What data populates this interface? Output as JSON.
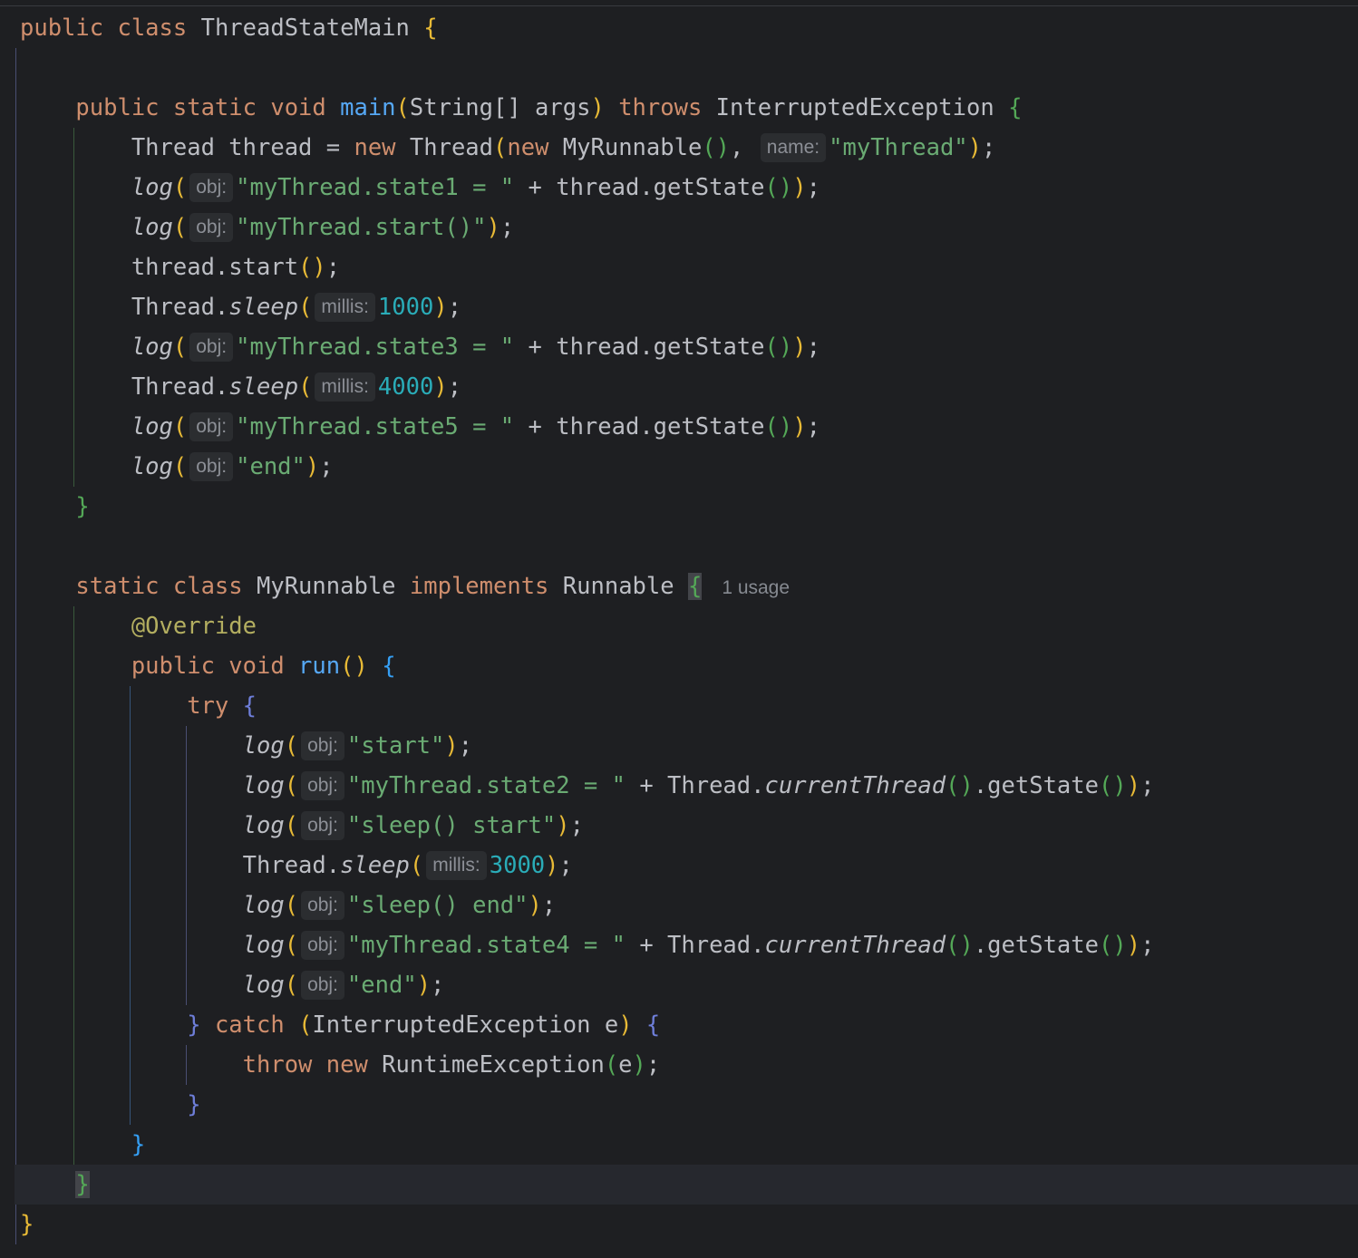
{
  "code": {
    "usage_hint": "1 usage",
    "lines": [
      {
        "tokens": [
          {
            "t": "public class ",
            "c": "kw"
          },
          {
            "t": "ThreadStateMain "
          },
          {
            "t": "{",
            "c": "p1"
          }
        ]
      },
      {
        "tokens": []
      },
      {
        "tokens": [
          {
            "t": "    public static void ",
            "c": "kw"
          },
          {
            "t": "main",
            "c": "fn"
          },
          {
            "t": "(",
            "c": "p1"
          },
          {
            "t": "String[] args"
          },
          {
            "t": ")",
            "c": "p1"
          },
          {
            "t": " throws ",
            "c": "kw"
          },
          {
            "t": "InterruptedException "
          },
          {
            "t": "{",
            "c": "p2"
          }
        ]
      },
      {
        "tokens": [
          {
            "t": "        Thread thread = "
          },
          {
            "t": "new ",
            "c": "kw"
          },
          {
            "t": "Thread"
          },
          {
            "t": "(",
            "c": "p1"
          },
          {
            "t": "new ",
            "c": "kw"
          },
          {
            "t": "MyRunnable"
          },
          {
            "t": "()",
            "c": "p2"
          },
          {
            "t": ", "
          },
          {
            "h": "name:"
          },
          {
            "t": "\"myThread\"",
            "c": "str"
          },
          {
            "t": ")",
            "c": "p1"
          },
          {
            "t": ";"
          }
        ]
      },
      {
        "tokens": [
          {
            "t": "        "
          },
          {
            "t": "log",
            "c": "it"
          },
          {
            "t": "(",
            "c": "p1"
          },
          {
            "h": "obj:"
          },
          {
            "t": "\"myThread.state1 = \"",
            "c": "str"
          },
          {
            "t": " + thread.getState"
          },
          {
            "t": "()",
            "c": "p2"
          },
          {
            "t": ")",
            "c": "p1"
          },
          {
            "t": ";"
          }
        ]
      },
      {
        "tokens": [
          {
            "t": "        "
          },
          {
            "t": "log",
            "c": "it"
          },
          {
            "t": "(",
            "c": "p1"
          },
          {
            "h": "obj:"
          },
          {
            "t": "\"myThread.start()\"",
            "c": "str"
          },
          {
            "t": ")",
            "c": "p1"
          },
          {
            "t": ";"
          }
        ]
      },
      {
        "tokens": [
          {
            "t": "        thread.start"
          },
          {
            "t": "()",
            "c": "p1"
          },
          {
            "t": ";"
          }
        ]
      },
      {
        "tokens": [
          {
            "t": "        Thread."
          },
          {
            "t": "sleep",
            "c": "it"
          },
          {
            "t": "(",
            "c": "p1"
          },
          {
            "h": "millis:"
          },
          {
            "t": "1000",
            "c": "num"
          },
          {
            "t": ")",
            "c": "p1"
          },
          {
            "t": ";"
          }
        ]
      },
      {
        "tokens": [
          {
            "t": "        "
          },
          {
            "t": "log",
            "c": "it"
          },
          {
            "t": "(",
            "c": "p1"
          },
          {
            "h": "obj:"
          },
          {
            "t": "\"myThread.state3 = \"",
            "c": "str"
          },
          {
            "t": " + thread.getState"
          },
          {
            "t": "()",
            "c": "p2"
          },
          {
            "t": ")",
            "c": "p1"
          },
          {
            "t": ";"
          }
        ]
      },
      {
        "tokens": [
          {
            "t": "        Thread."
          },
          {
            "t": "sleep",
            "c": "it"
          },
          {
            "t": "(",
            "c": "p1"
          },
          {
            "h": "millis:"
          },
          {
            "t": "4000",
            "c": "num"
          },
          {
            "t": ")",
            "c": "p1"
          },
          {
            "t": ";"
          }
        ]
      },
      {
        "tokens": [
          {
            "t": "        "
          },
          {
            "t": "log",
            "c": "it"
          },
          {
            "t": "(",
            "c": "p1"
          },
          {
            "h": "obj:"
          },
          {
            "t": "\"myThread.state5 = \"",
            "c": "str"
          },
          {
            "t": " + thread.getState"
          },
          {
            "t": "()",
            "c": "p2"
          },
          {
            "t": ")",
            "c": "p1"
          },
          {
            "t": ";"
          }
        ]
      },
      {
        "tokens": [
          {
            "t": "        "
          },
          {
            "t": "log",
            "c": "it"
          },
          {
            "t": "(",
            "c": "p1"
          },
          {
            "h": "obj:"
          },
          {
            "t": "\"end\"",
            "c": "str"
          },
          {
            "t": ")",
            "c": "p1"
          },
          {
            "t": ";"
          }
        ]
      },
      {
        "tokens": [
          {
            "t": "    "
          },
          {
            "t": "}",
            "c": "p2"
          }
        ]
      },
      {
        "tokens": []
      },
      {
        "tokens": [
          {
            "t": "    static class ",
            "c": "kw"
          },
          {
            "t": "MyRunnable "
          },
          {
            "t": "implements ",
            "c": "kw"
          },
          {
            "t": "Runnable "
          },
          {
            "t": "{",
            "c": "p2",
            "hl": true
          },
          {
            "usage": true
          }
        ]
      },
      {
        "tokens": [
          {
            "t": "        "
          },
          {
            "t": "@Override",
            "c": "ann"
          }
        ]
      },
      {
        "tokens": [
          {
            "t": "        public void ",
            "c": "kw"
          },
          {
            "t": "run",
            "c": "fn"
          },
          {
            "t": "()",
            "c": "p1"
          },
          {
            "t": " "
          },
          {
            "t": "{",
            "c": "p3"
          }
        ]
      },
      {
        "tokens": [
          {
            "t": "            try ",
            "c": "kw"
          },
          {
            "t": "{",
            "c": "p4"
          }
        ]
      },
      {
        "tokens": [
          {
            "t": "                "
          },
          {
            "t": "log",
            "c": "it"
          },
          {
            "t": "(",
            "c": "p1"
          },
          {
            "h": "obj:"
          },
          {
            "t": "\"start\"",
            "c": "str"
          },
          {
            "t": ")",
            "c": "p1"
          },
          {
            "t": ";"
          }
        ]
      },
      {
        "tokens": [
          {
            "t": "                "
          },
          {
            "t": "log",
            "c": "it"
          },
          {
            "t": "(",
            "c": "p1"
          },
          {
            "h": "obj:"
          },
          {
            "t": "\"myThread.state2 = \"",
            "c": "str"
          },
          {
            "t": " + Thread."
          },
          {
            "t": "currentThread",
            "c": "it"
          },
          {
            "t": "()",
            "c": "p2"
          },
          {
            "t": ".getState"
          },
          {
            "t": "()",
            "c": "p2"
          },
          {
            "t": ")",
            "c": "p1"
          },
          {
            "t": ";"
          }
        ]
      },
      {
        "tokens": [
          {
            "t": "                "
          },
          {
            "t": "log",
            "c": "it"
          },
          {
            "t": "(",
            "c": "p1"
          },
          {
            "h": "obj:"
          },
          {
            "t": "\"sleep() start\"",
            "c": "str"
          },
          {
            "t": ")",
            "c": "p1"
          },
          {
            "t": ";"
          }
        ]
      },
      {
        "tokens": [
          {
            "t": "                Thread."
          },
          {
            "t": "sleep",
            "c": "it"
          },
          {
            "t": "(",
            "c": "p1"
          },
          {
            "h": "millis:"
          },
          {
            "t": "3000",
            "c": "num"
          },
          {
            "t": ")",
            "c": "p1"
          },
          {
            "t": ";"
          }
        ]
      },
      {
        "tokens": [
          {
            "t": "                "
          },
          {
            "t": "log",
            "c": "it"
          },
          {
            "t": "(",
            "c": "p1"
          },
          {
            "h": "obj:"
          },
          {
            "t": "\"sleep() end\"",
            "c": "str"
          },
          {
            "t": ")",
            "c": "p1"
          },
          {
            "t": ";"
          }
        ]
      },
      {
        "tokens": [
          {
            "t": "                "
          },
          {
            "t": "log",
            "c": "it"
          },
          {
            "t": "(",
            "c": "p1"
          },
          {
            "h": "obj:"
          },
          {
            "t": "\"myThread.state4 = \"",
            "c": "str"
          },
          {
            "t": " + Thread."
          },
          {
            "t": "currentThread",
            "c": "it"
          },
          {
            "t": "()",
            "c": "p2"
          },
          {
            "t": ".getState"
          },
          {
            "t": "()",
            "c": "p2"
          },
          {
            "t": ")",
            "c": "p1"
          },
          {
            "t": ";"
          }
        ]
      },
      {
        "tokens": [
          {
            "t": "                "
          },
          {
            "t": "log",
            "c": "it"
          },
          {
            "t": "(",
            "c": "p1"
          },
          {
            "h": "obj:"
          },
          {
            "t": "\"end\"",
            "c": "str"
          },
          {
            "t": ")",
            "c": "p1"
          },
          {
            "t": ";"
          }
        ]
      },
      {
        "tokens": [
          {
            "t": "            "
          },
          {
            "t": "}",
            "c": "p4"
          },
          {
            "t": " catch ",
            "c": "kw"
          },
          {
            "t": "(",
            "c": "p1"
          },
          {
            "t": "InterruptedException e"
          },
          {
            "t": ")",
            "c": "p1"
          },
          {
            "t": " "
          },
          {
            "t": "{",
            "c": "p4"
          }
        ]
      },
      {
        "tokens": [
          {
            "t": "                throw new ",
            "c": "kw"
          },
          {
            "t": "RuntimeException"
          },
          {
            "t": "(",
            "c": "p2"
          },
          {
            "t": "e"
          },
          {
            "t": ")",
            "c": "p2"
          },
          {
            "t": ";"
          }
        ]
      },
      {
        "tokens": [
          {
            "t": "            "
          },
          {
            "t": "}",
            "c": "p4"
          }
        ]
      },
      {
        "tokens": [
          {
            "t": "        "
          },
          {
            "t": "}",
            "c": "p3"
          }
        ]
      },
      {
        "tokens": [
          {
            "t": "    "
          },
          {
            "t": "}",
            "c": "p2",
            "hl": true
          }
        ]
      },
      {
        "tokens": [
          {
            "t": "}",
            "c": "p1"
          }
        ]
      }
    ]
  }
}
